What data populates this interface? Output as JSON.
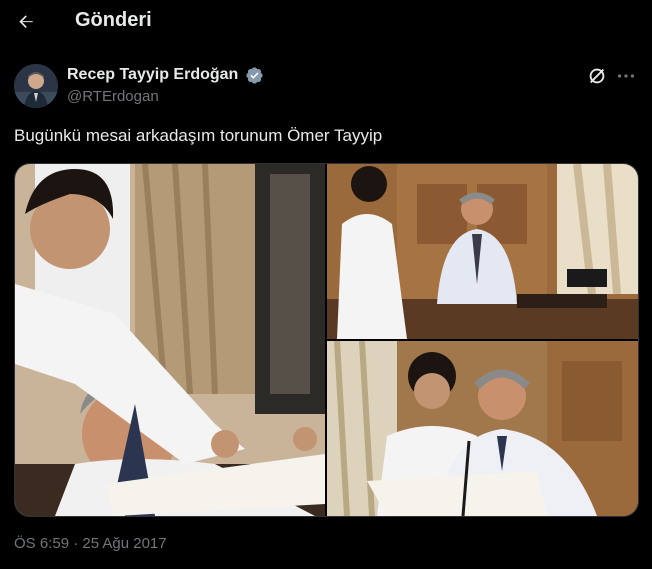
{
  "header": {
    "back_icon": "arrow-left-icon",
    "title": "Gönderi"
  },
  "tweet": {
    "author": {
      "name": "Recep Tayyip Erdoğan",
      "handle": "@RTErdogan",
      "verified_icon": "verified-badge-icon",
      "verified_color": "#829aab"
    },
    "actions": {
      "grok_icon": "grok-icon",
      "more_icon": "more-horizontal-icon"
    },
    "text": "Bugünkü mesai arkadaşım torunum Ömer Tayyip",
    "media": [
      {
        "icon": "photo-man-and-boy-at-desk-closeup"
      },
      {
        "icon": "photo-boy-standing-by-desk"
      },
      {
        "icon": "photo-man-and-boy-reading-papers"
      }
    ],
    "timestamp": "ÖS 6:59 · 25 Ağu 2017"
  },
  "colors": {
    "background": "#000000",
    "primary_text": "#e7e9ea",
    "secondary_text": "#71767b",
    "border": "#2f3336"
  }
}
